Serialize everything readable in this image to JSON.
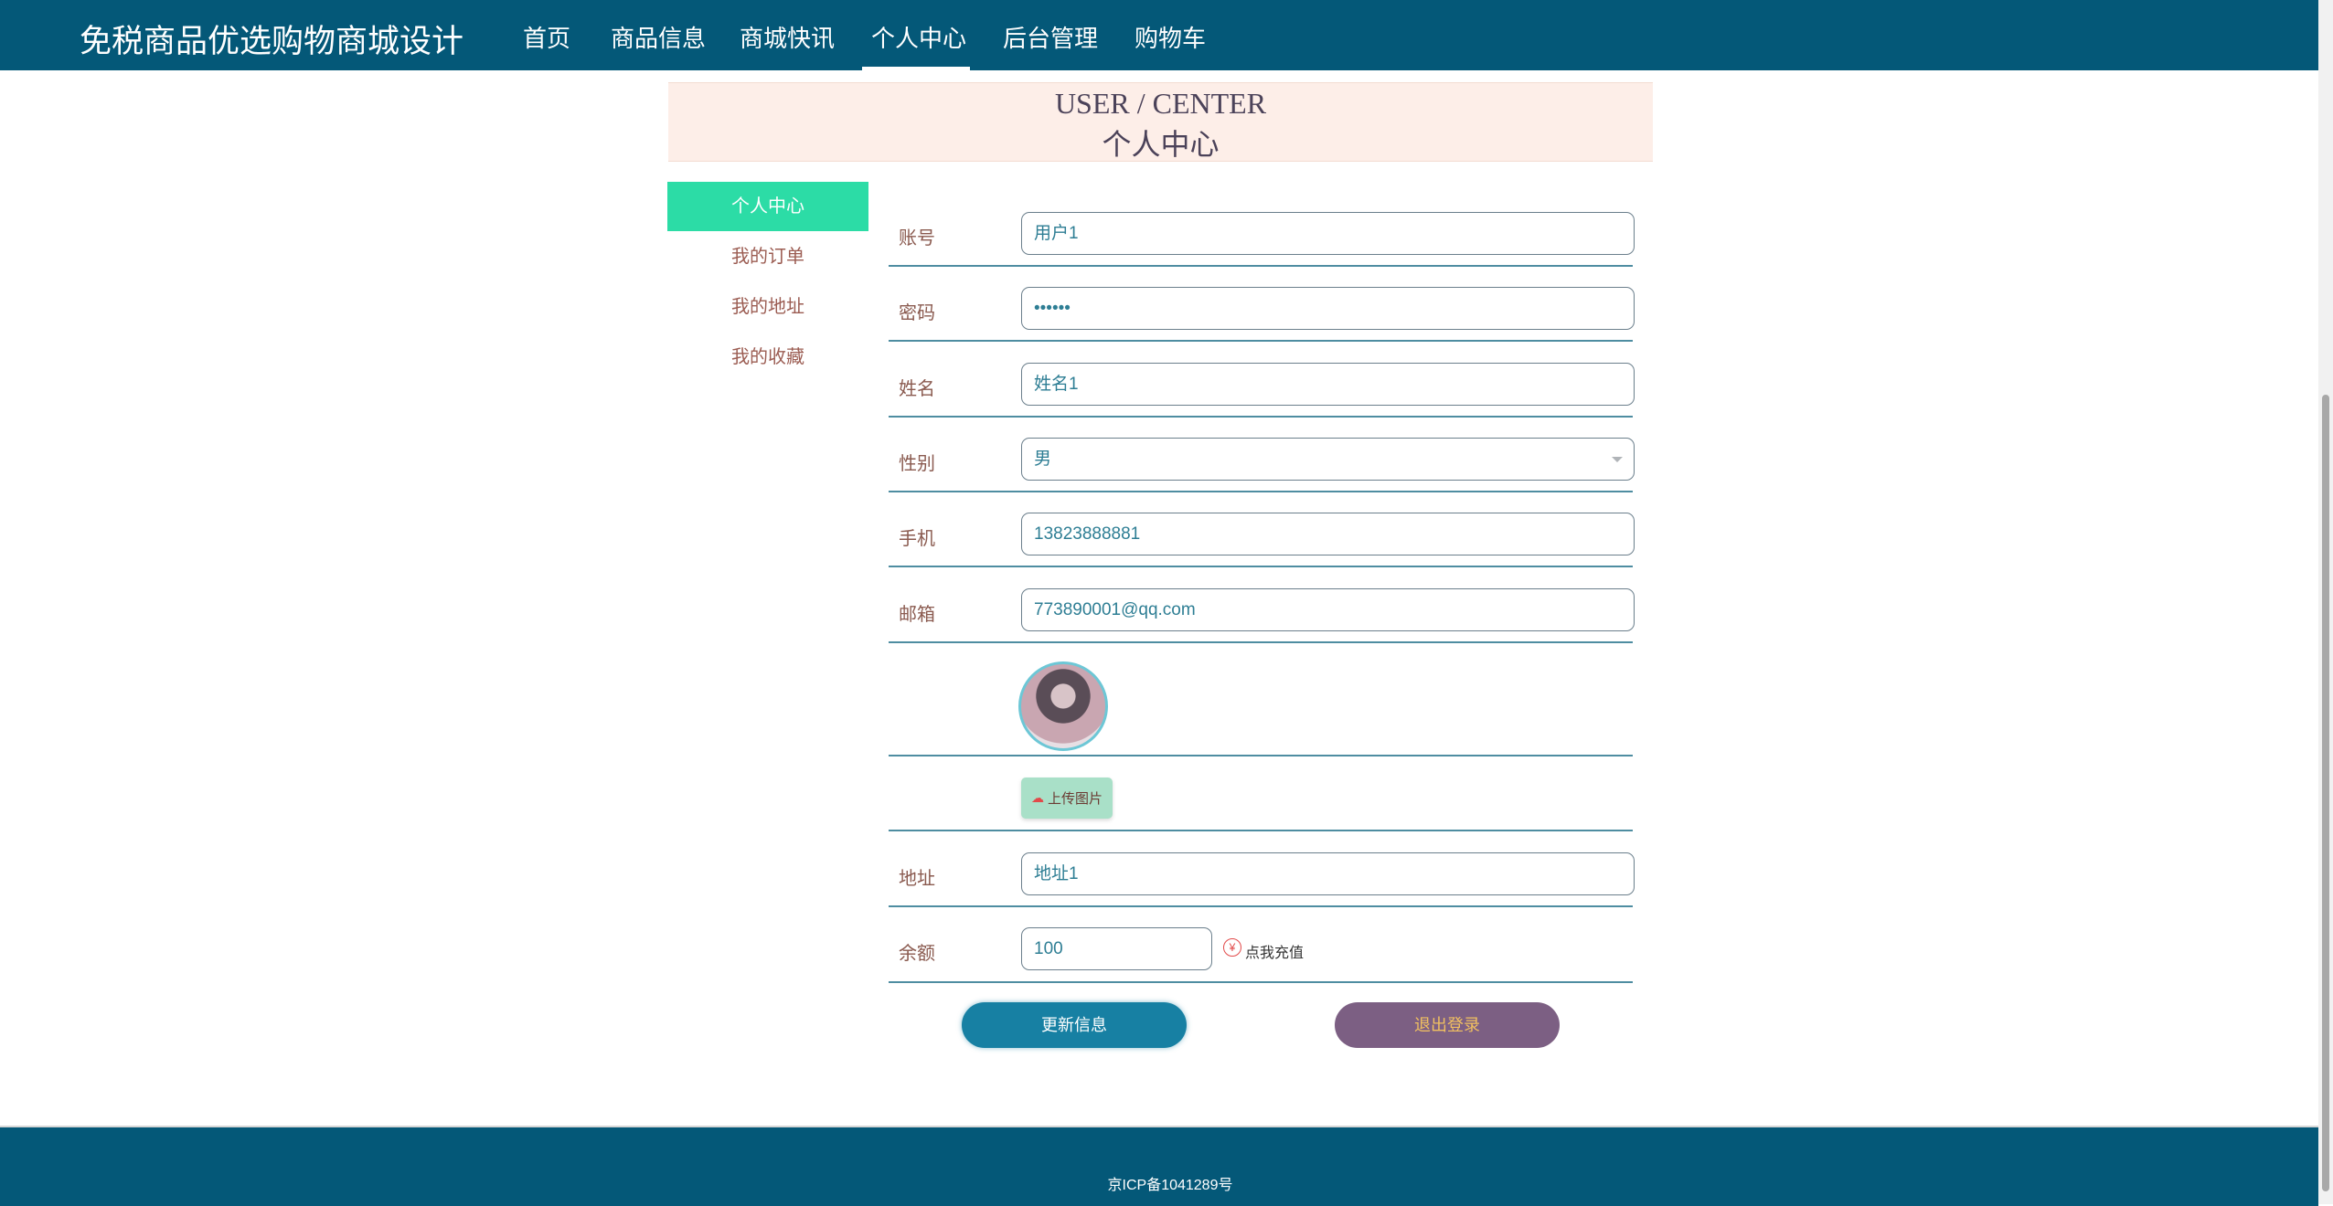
{
  "header": {
    "site_title": "免税商品优选购物商城设计",
    "nav": [
      "首页",
      "商品信息",
      "商城快讯",
      "个人中心",
      "后台管理",
      "购物车"
    ],
    "active_nav": "个人中心"
  },
  "banner": {
    "title_en": "USER / CENTER",
    "title_cn": "个人中心"
  },
  "sidebar": {
    "items": [
      {
        "label": "个人中心",
        "active": true
      },
      {
        "label": "我的订单",
        "active": false
      },
      {
        "label": "我的地址",
        "active": false
      },
      {
        "label": "我的收藏",
        "active": false
      }
    ]
  },
  "form": {
    "account": {
      "label": "账号",
      "value": "用户1"
    },
    "password": {
      "label": "密码",
      "value": "••••••"
    },
    "name": {
      "label": "姓名",
      "value": "姓名1"
    },
    "gender": {
      "label": "性别",
      "value": "男"
    },
    "phone": {
      "label": "手机",
      "value": "13823888881"
    },
    "email": {
      "label": "邮箱",
      "value": "773890001@qq.com"
    },
    "upload_button": "上传图片",
    "address": {
      "label": "地址",
      "value": "地址1"
    },
    "balance": {
      "label": "余额",
      "value": "100"
    },
    "recharge_icon": "¥",
    "recharge_text": "点我充值",
    "update_button": "更新信息",
    "logout_button": "退出登录"
  },
  "footer": {
    "icp": "京ICP备1041289号"
  },
  "colors": {
    "header_bg": "#045878",
    "active_menu": "#2cdca6",
    "update_button": "#1780a3",
    "logout_button": "#7c5f83"
  }
}
